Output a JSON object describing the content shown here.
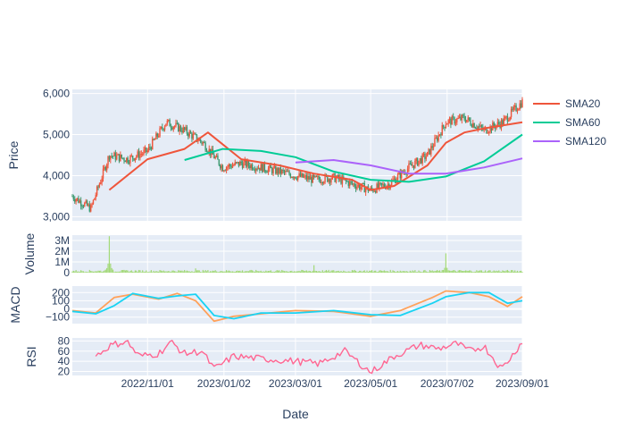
{
  "chart_data": {
    "type": "stock-dashboard",
    "xlabel": "Date",
    "x_ticks": [
      "2022/11/01",
      "2023/01/02",
      "2023/03/01",
      "2023/05/01",
      "2023/07/02",
      "2023/09/01"
    ],
    "x_range": [
      "2022/09/01",
      "2023/09/01"
    ],
    "colors": {
      "increasing": "#ef553b",
      "decreasing": "#3d9970",
      "sma20": "#ef553b",
      "sma60": "#00cc96",
      "sma120": "#ab63fa",
      "volume": "#a3d977",
      "macd": "#ffa15a",
      "signal": "#19d3f3",
      "rsi": "#ff6692",
      "panel_bg": "#e5ecf6",
      "grid": "#ffffff"
    },
    "panels": [
      {
        "id": "price",
        "ylabel": "Price",
        "ylim": [
          2900,
          6100
        ],
        "yticks": [
          3000,
          4000,
          5000,
          6000
        ],
        "ytick_labels": [
          "3,000",
          "4,000",
          "5,000",
          "6,000"
        ],
        "candles": {
          "dates": [
            "2022/09/01",
            "2022/09/16",
            "2022/10/01",
            "2022/10/16",
            "2022/11/01",
            "2022/11/16",
            "2022/12/01",
            "2022/12/16",
            "2023/01/01",
            "2023/01/16",
            "2023/02/01",
            "2023/02/16",
            "2023/03/01",
            "2023/03/16",
            "2023/04/01",
            "2023/04/16",
            "2023/05/01",
            "2023/05/16",
            "2023/06/01",
            "2023/06/16",
            "2023/07/01",
            "2023/07/16",
            "2023/08/01",
            "2023/08/16",
            "2023/09/01"
          ],
          "close": [
            3500,
            3200,
            4500,
            4400,
            4600,
            5300,
            5100,
            4800,
            4200,
            4300,
            4200,
            4100,
            4000,
            3900,
            3950,
            3800,
            3650,
            3800,
            4200,
            4500,
            5300,
            5400,
            5100,
            5300,
            5800
          ]
        },
        "series": [
          {
            "name": "SMA20",
            "x": [
              "2022/10/01",
              "2022/11/01",
              "2022/12/01",
              "2022/12/20",
              "2023/01/16",
              "2023/02/16",
              "2023/03/16",
              "2023/04/16",
              "2023/05/01",
              "2023/05/20",
              "2023/06/16",
              "2023/07/01",
              "2023/07/16",
              "2023/08/01",
              "2023/09/01"
            ],
            "y": [
              3650,
              4400,
              4650,
              5050,
              4400,
              4250,
              4050,
              3900,
              3650,
              3750,
              4250,
              4800,
              5050,
              5150,
              5300
            ]
          },
          {
            "name": "SMA60",
            "x": [
              "2022/12/01",
              "2023/01/01",
              "2023/02/01",
              "2023/03/01",
              "2023/04/01",
              "2023/05/01",
              "2023/06/01",
              "2023/07/01",
              "2023/08/01",
              "2023/09/01"
            ],
            "y": [
              4380,
              4650,
              4600,
              4450,
              4100,
              3900,
              3850,
              3980,
              4350,
              5000
            ]
          },
          {
            "name": "SMA120",
            "x": [
              "2023/03/01",
              "2023/04/01",
              "2023/05/01",
              "2023/06/01",
              "2023/07/01",
              "2023/08/01",
              "2023/09/01"
            ],
            "y": [
              4320,
              4380,
              4250,
              4050,
              4050,
              4200,
              4420
            ]
          }
        ]
      },
      {
        "id": "volume",
        "ylabel": "Volume",
        "ylim": [
          0,
          3500000
        ],
        "yticks": [
          0,
          1000000,
          2000000,
          3000000
        ],
        "ytick_labels": [
          "0",
          "1M",
          "2M",
          "3M"
        ],
        "spikes": [
          {
            "x": "2022/10/01",
            "y": 3400000
          },
          {
            "x": "2023/07/01",
            "y": 1800000
          },
          {
            "x": "2023/03/16",
            "y": 700000
          },
          {
            "x": "2022/12/10",
            "y": 400000
          }
        ],
        "baseline": 200000
      },
      {
        "id": "macd",
        "ylabel": "MACD",
        "ylim": [
          -180,
          280
        ],
        "yticks": [
          -100,
          0,
          100,
          200
        ],
        "ytick_labels": [
          "−100",
          "0",
          "100",
          "200"
        ],
        "series": [
          {
            "name": "",
            "x": [
              "2022/09/01",
              "2022/09/20",
              "2022/10/05",
              "2022/10/20",
              "2022/11/10",
              "2022/11/25",
              "2022/12/10",
              "2022/12/25",
              "2023/01/10",
              "2023/02/01",
              "2023/03/01",
              "2023/04/01",
              "2023/05/01",
              "2023/05/25",
              "2023/06/20",
              "2023/07/01",
              "2023/07/20",
              "2023/08/05",
              "2023/08/20",
              "2023/09/01"
            ],
            "y": [
              -20,
              -50,
              140,
              180,
              120,
              190,
              100,
              -150,
              -90,
              -60,
              -20,
              -30,
              -90,
              -20,
              140,
              220,
              200,
              150,
              30,
              150
            ]
          },
          {
            "name": "",
            "x": [
              "2022/09/01",
              "2022/09/20",
              "2022/10/05",
              "2022/10/20",
              "2022/11/10",
              "2022/11/25",
              "2022/12/10",
              "2022/12/25",
              "2023/01/10",
              "2023/02/01",
              "2023/03/01",
              "2023/04/01",
              "2023/05/01",
              "2023/05/25",
              "2023/06/20",
              "2023/07/01",
              "2023/07/20",
              "2023/08/05",
              "2023/08/20",
              "2023/09/01"
            ],
            "y": [
              -30,
              -60,
              40,
              190,
              130,
              160,
              180,
              -80,
              -120,
              -50,
              -50,
              -20,
              -70,
              -80,
              70,
              150,
              200,
              200,
              70,
              100
            ]
          }
        ]
      },
      {
        "id": "rsi",
        "ylabel": "RSI",
        "ylim": [
          12,
          86
        ],
        "yticks": [
          20,
          40,
          60,
          80
        ],
        "ytick_labels": [
          "20",
          "40",
          "60",
          "80"
        ],
        "series": [
          {
            "name": "",
            "x": [
              "2022/09/20",
              "2022/10/01",
              "2022/10/15",
              "2022/10/25",
              "2022/11/10",
              "2022/11/20",
              "2022/12/01",
              "2022/12/15",
              "2022/12/25",
              "2023/01/10",
              "2023/02/01",
              "2023/03/01",
              "2023/03/20",
              "2023/04/10",
              "2023/05/01",
              "2023/05/20",
              "2023/06/10",
              "2023/06/25",
              "2023/07/10",
              "2023/07/20",
              "2023/08/01",
              "2023/08/15",
              "2023/08/25",
              "2023/09/01"
            ],
            "y": [
              50,
              70,
              80,
              50,
              55,
              78,
              55,
              60,
              25,
              50,
              45,
              40,
              35,
              60,
              18,
              50,
              72,
              65,
              75,
              60,
              70,
              25,
              55,
              80
            ]
          }
        ]
      }
    ],
    "legend": {
      "placement": "top-right",
      "entries": [
        "SMA20",
        "SMA60",
        "SMA120"
      ]
    }
  }
}
